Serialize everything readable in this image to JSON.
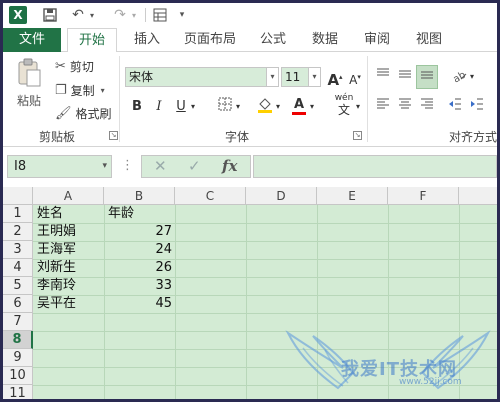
{
  "app": {
    "logo": "X"
  },
  "qat": {
    "save_icon": "save-icon",
    "undo_icon": "undo-icon",
    "redo_icon": "redo-icon",
    "form_icon": "form-icon",
    "customize_icon": "customize-icon"
  },
  "tabs": [
    "文件",
    "开始",
    "插入",
    "页面布局",
    "公式",
    "数据",
    "审阅",
    "视图"
  ],
  "ribbon": {
    "clipboard": {
      "paste": "粘贴",
      "cut": "剪切",
      "copy": "复制",
      "format_painter": "格式刷",
      "label": "剪贴板"
    },
    "font": {
      "name": "宋体",
      "size": "11",
      "label": "字体",
      "bold": "B",
      "italic": "I",
      "underline": "U",
      "grow": "A",
      "shrink": "A",
      "wen": "wén"
    },
    "alignment": {
      "label": "对齐方式"
    }
  },
  "formula_bar": {
    "name_box": "I8",
    "fx": "fx",
    "cancel": "✕",
    "enter": "✓",
    "value": ""
  },
  "sheet": {
    "columns": [
      "A",
      "B",
      "C",
      "D",
      "E",
      "F"
    ],
    "rows": [
      "1",
      "2",
      "3",
      "4",
      "5",
      "6",
      "7",
      "8",
      "9",
      "10",
      "11"
    ],
    "selected_row": "8",
    "headers": [
      "姓名",
      "年龄"
    ],
    "data": [
      {
        "name": "王明娟",
        "age": "27"
      },
      {
        "name": "王海军",
        "age": "24"
      },
      {
        "name": "刘新生",
        "age": "26"
      },
      {
        "name": "李南玲",
        "age": "33"
      },
      {
        "name": "吴平在",
        "age": "45"
      }
    ]
  },
  "watermark": {
    "text": "我爱IT技术网",
    "url": "www.52ij.com"
  },
  "colors": {
    "accent": "#217346",
    "cell_bg": "#d3ebd4"
  }
}
